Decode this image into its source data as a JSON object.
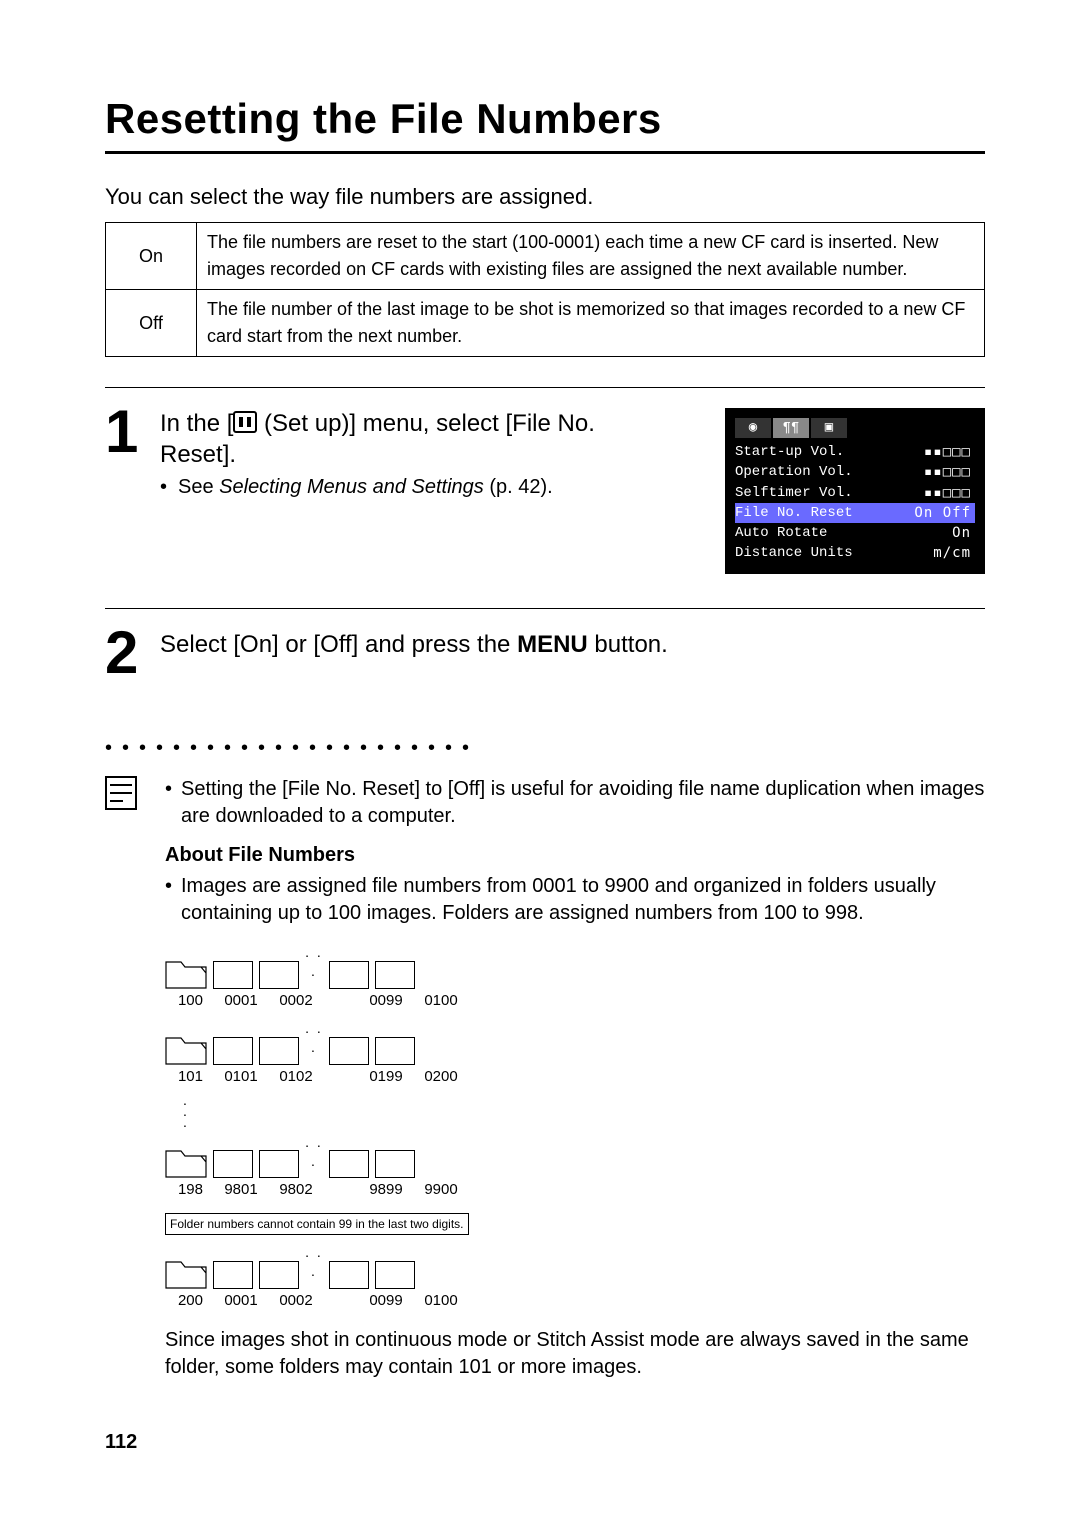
{
  "title": "Resetting the File Numbers",
  "intro": "You can select the way file numbers are assigned.",
  "table": {
    "on_label": "On",
    "on_desc": "The file numbers are reset to the start (100-0001) each time a new CF card is inserted. New images recorded on CF cards with existing files are assigned the next available number.",
    "off_label": "Off",
    "off_desc": "The file number of the last image to be shot is memorized so that images recorded to a new CF card start from the next number."
  },
  "step1": {
    "num": "1",
    "title_pre": "In the [",
    "title_post": " (Set up)] menu, select [File No. Reset].",
    "sub_pre": "See ",
    "sub_italic": "Selecting Menus and Settings",
    "sub_post": " (p. 42)."
  },
  "menu": {
    "rows": [
      {
        "label": "Start-up Vol.",
        "val": "▪▪□□□"
      },
      {
        "label": "Operation Vol.",
        "val": "▪▪□□□"
      },
      {
        "label": "Selftimer Vol.",
        "val": "▪▪□□□"
      },
      {
        "label": "File No. Reset",
        "val": "On Off",
        "hl": true
      },
      {
        "label": "Auto Rotate",
        "val": "On"
      },
      {
        "label": "Distance Units",
        "val": "m/cm"
      }
    ]
  },
  "step2": {
    "num": "2",
    "text_pre": "Select [On] or [Off] and press the ",
    "text_bold": "MENU",
    "text_post": " button."
  },
  "note": "Setting the [File No. Reset] to [Off] is useful for avoiding file name duplication when images are downloaded to a computer.",
  "about": {
    "heading": "About File Numbers",
    "para": "Images are assigned file numbers from 0001 to 9900 and organized in folders usually containing up to 100 images. Folders are assigned numbers from 100 to 998.",
    "rows": [
      {
        "folder": "100",
        "files": [
          "0001",
          "0002",
          "0099",
          "0100"
        ]
      },
      {
        "folder": "101",
        "files": [
          "0101",
          "0102",
          "0199",
          "0200"
        ]
      },
      {
        "folder": "198",
        "files": [
          "9801",
          "9802",
          "9899",
          "9900"
        ]
      },
      {
        "folder": "200",
        "files": [
          "0001",
          "0002",
          "0099",
          "0100"
        ]
      }
    ],
    "folder_note": "Folder numbers cannot contain 99 in the last two digits.",
    "trailer": "Since images shot in continuous mode or Stitch Assist mode are always saved in the same folder, some folders may contain 101 or more images."
  },
  "page_number": "112"
}
